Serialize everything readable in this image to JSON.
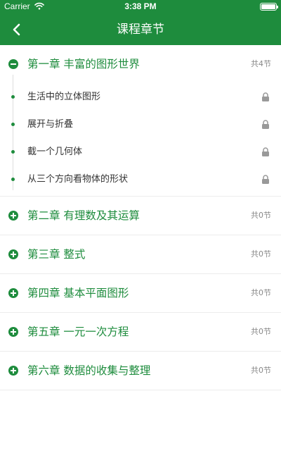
{
  "status_bar": {
    "carrier": "Carrier",
    "time": "3:38 PM"
  },
  "nav": {
    "title": "课程章节",
    "back_icon": "chevron-left-icon"
  },
  "colors": {
    "brand": "#1e8c3d",
    "text": "#333333",
    "muted": "#888888",
    "lock": "#999999"
  },
  "chapters": [
    {
      "title": "第一章 丰富的图形世界",
      "count": "共4节",
      "expanded": true,
      "sections": [
        {
          "title": "生活中的立体图形",
          "locked": true
        },
        {
          "title": "展开与折叠",
          "locked": true
        },
        {
          "title": "截一个几何体",
          "locked": true
        },
        {
          "title": "从三个方向看物体的形状",
          "locked": true
        }
      ]
    },
    {
      "title": "第二章 有理数及其运算",
      "count": "共0节",
      "expanded": false,
      "sections": []
    },
    {
      "title": "第三章 整式",
      "count": "共0节",
      "expanded": false,
      "sections": []
    },
    {
      "title": "第四章 基本平面图形",
      "count": "共0节",
      "expanded": false,
      "sections": []
    },
    {
      "title": "第五章 一元一次方程",
      "count": "共0节",
      "expanded": false,
      "sections": []
    },
    {
      "title": "第六章 数据的收集与整理",
      "count": "共0节",
      "expanded": false,
      "sections": []
    }
  ]
}
